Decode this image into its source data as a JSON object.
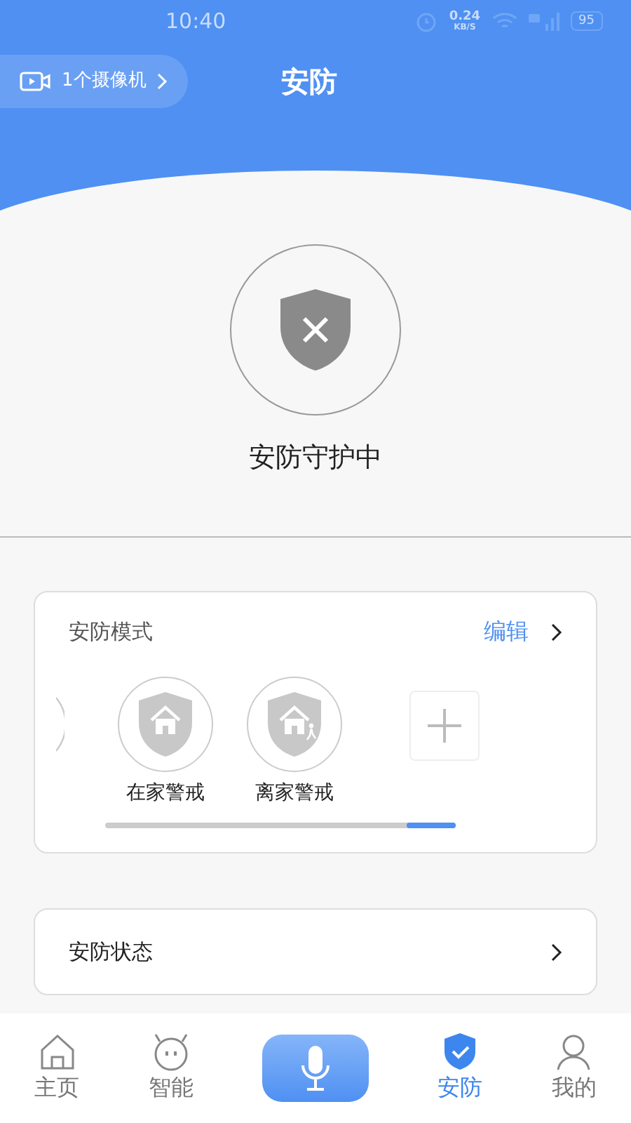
{
  "status_bar": {
    "time": "10:40",
    "speed_value": "0.24",
    "speed_unit": "KB/S",
    "battery": "95"
  },
  "header": {
    "camera_link": "1个摄像机",
    "title": "安防"
  },
  "guard": {
    "status": "安防守护中"
  },
  "modes_card": {
    "title": "安防模式",
    "edit_link": "编辑",
    "modes": [
      {
        "label": "在家警戒",
        "kind": "home"
      },
      {
        "label": "离家警戒",
        "kind": "away"
      }
    ]
  },
  "status_row": {
    "label": "安防状态"
  },
  "tabs": [
    {
      "label": "主页",
      "kind": "home",
      "selected": false
    },
    {
      "label": "智能",
      "kind": "robot",
      "selected": false
    },
    {
      "kind": "voice",
      "selected": false
    },
    {
      "label": "安防",
      "kind": "shield",
      "selected": true
    },
    {
      "label": "我的",
      "kind": "person",
      "selected": false
    }
  ]
}
